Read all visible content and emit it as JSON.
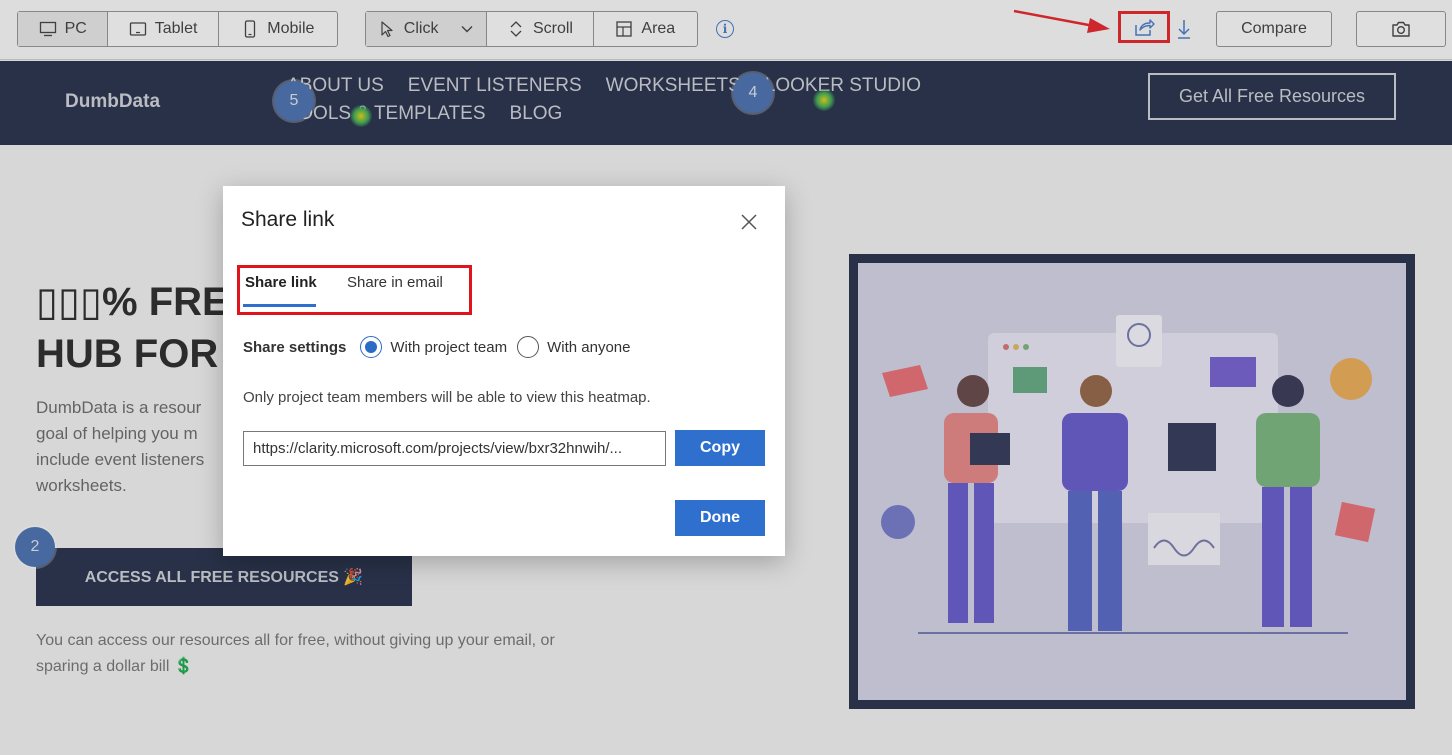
{
  "toolbar": {
    "devices": [
      {
        "label": "PC",
        "icon": "monitor-icon"
      },
      {
        "label": "Tablet",
        "icon": "tablet-icon"
      },
      {
        "label": "Mobile",
        "icon": "mobile-icon"
      }
    ],
    "modes": [
      {
        "label": "Click",
        "icon": "cursor-icon"
      },
      {
        "label": "Scroll",
        "icon": "scroll-icon"
      },
      {
        "label": "Area",
        "icon": "area-icon"
      }
    ],
    "info_icon": "i",
    "compare_label": "Compare",
    "accent_color": "#e0151c"
  },
  "site": {
    "logo": "DumbData",
    "menu": [
      "ABOUT US",
      "EVENT LISTENERS",
      "WORKSHEETS",
      "LOOKER STUDIO",
      "TOOLS & TEMPLATES",
      "BLOG"
    ],
    "header_cta": "Get All Free Resources",
    "hero_title_line1": "▯▯▯% FREE",
    "hero_title_line2": "HUB FOR",
    "hero_desc": "DumbData is a resour... goal of helping you m... include event listeners... worksheets.",
    "hero_desc_lines": [
      "DumbData is a resour",
      "goal of helping you m",
      "include event listeners",
      "worksheets."
    ],
    "cta": "ACCESS ALL FREE RESOURCES 🎉",
    "sub_text": "You can access our resources all for free, without giving up your email, or sparing a dollar bill 💲",
    "badges": [
      "5",
      "4",
      "2"
    ]
  },
  "modal": {
    "title": "Share link",
    "tabs": [
      "Share link",
      "Share in email"
    ],
    "settings_label": "Share settings",
    "options": [
      "With project team",
      "With anyone"
    ],
    "selected_option": "With project team",
    "note": "Only project team members will be able to view this heatmap.",
    "url": "https://clarity.microsoft.com/projects/view/bxr32hnwih/...",
    "copy_label": "Copy",
    "done_label": "Done"
  }
}
